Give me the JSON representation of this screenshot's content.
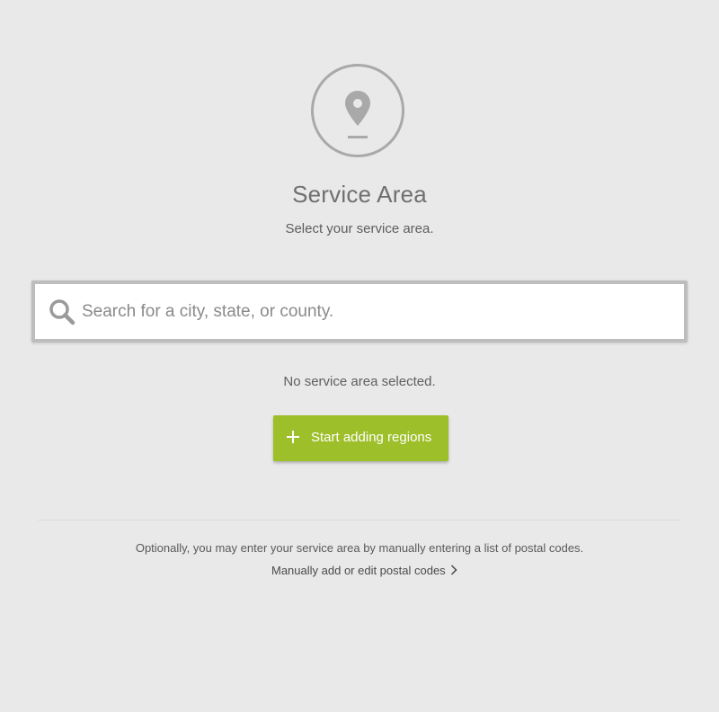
{
  "header": {
    "icon": "map-pin-icon",
    "title": "Service Area",
    "subtitle": "Select your service area."
  },
  "search": {
    "icon": "search-icon",
    "value": "",
    "placeholder": "Search for a city, state, or county."
  },
  "status": {
    "empty_text": "No service area selected."
  },
  "add_button": {
    "icon": "plus-icon",
    "label": "Start adding regions",
    "color": "#9dbf2a"
  },
  "footer": {
    "note": "Optionally, you may enter your service area by manually entering a list of postal codes.",
    "link_label": "Manually add or edit postal codes",
    "link_icon": "chevron-right-icon"
  }
}
